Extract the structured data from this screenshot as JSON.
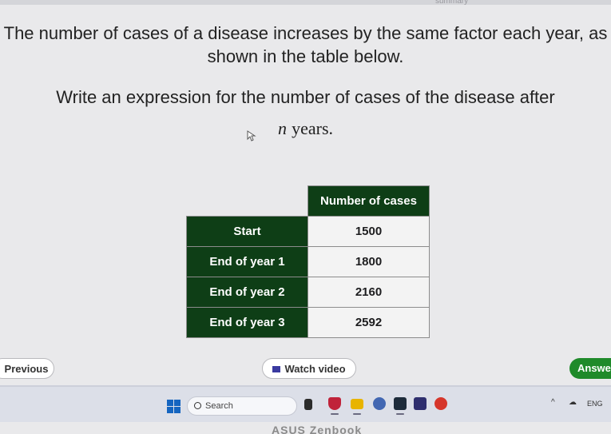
{
  "top": {
    "label": "summary"
  },
  "question": {
    "line1": "The number of cases of a disease increases by the same factor each year, as shown in the table below.",
    "line2": "Write an expression for the number of cases of the disease after",
    "variable": "n",
    "suffix": "years."
  },
  "table": {
    "header": "Number of cases",
    "rows": [
      {
        "label": "Start",
        "value": "1500"
      },
      {
        "label": "End of year 1",
        "value": "1800"
      },
      {
        "label": "End of year 2",
        "value": "2160"
      },
      {
        "label": "End of year 3",
        "value": "2592"
      }
    ]
  },
  "nav": {
    "previous_label": "Previous",
    "watch_label": "Watch video",
    "answer_label": "Answe"
  },
  "taskbar": {
    "search_placeholder": "Search",
    "tray_language": "ENG"
  },
  "footer": {
    "text": "ASUS Zenbook"
  },
  "colors": {
    "table_header_bg": "#0e3e16",
    "answer_button_bg": "#1f8a2a"
  }
}
